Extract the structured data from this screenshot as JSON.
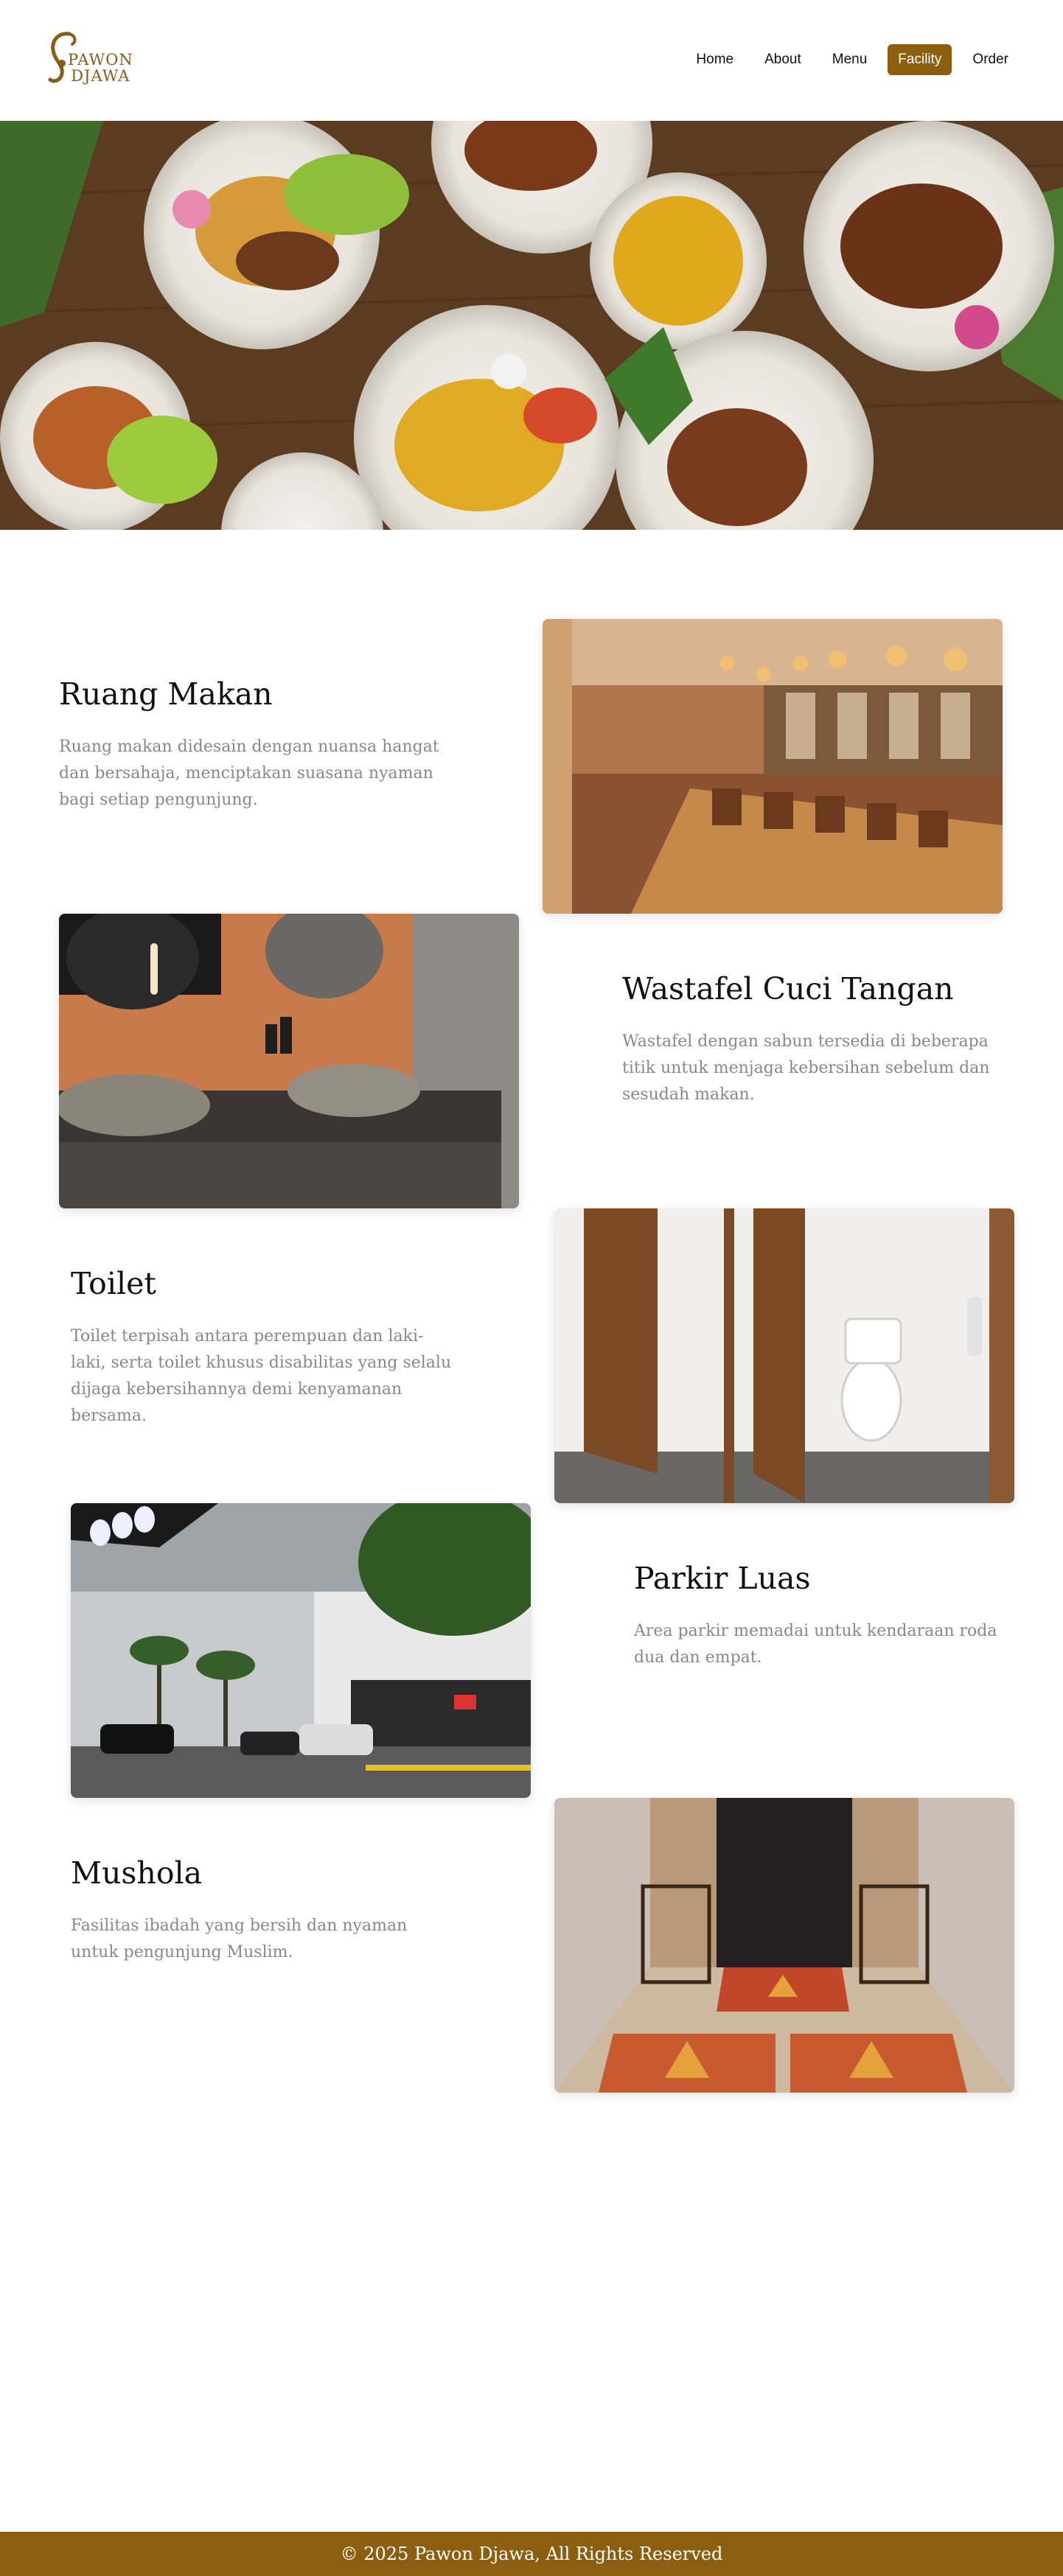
{
  "brand": {
    "logo_line1": "PAWON",
    "logo_line2": "DJAWA",
    "accent_color": "#8b5e10"
  },
  "nav": [
    {
      "label": "Home",
      "active": false
    },
    {
      "label": "About",
      "active": false
    },
    {
      "label": "Menu",
      "active": false
    },
    {
      "label": "Facility",
      "active": true
    },
    {
      "label": "Order",
      "active": false
    }
  ],
  "facilities": [
    {
      "title": "Ruang Makan",
      "description": "Ruang makan didesain dengan nuansa hangat dan bersahaja, menciptakan suasana nyaman bagi setiap pengunjung.",
      "image": "dining-room-photo"
    },
    {
      "title": "Wastafel Cuci Tangan",
      "description": "Wastafel dengan sabun tersedia di beberapa titik untuk menjaga kebersihan sebelum dan sesudah makan.",
      "image": "sink-photo"
    },
    {
      "title": "Toilet",
      "description": "Toilet terpisah antara perempuan dan laki-laki, serta toilet khusus disabilitas yang selalu dijaga kebersihannya demi kenyamanan bersama.",
      "image": "toilet-photo"
    },
    {
      "title": "Parkir Luas",
      "description": "Area parkir memadai untuk kendaraan roda dua dan empat.",
      "image": "parking-photo"
    },
    {
      "title": "Mushola",
      "description": "Fasilitas ibadah yang bersih dan nyaman untuk pengunjung Muslim.",
      "image": "prayer-room-photo"
    }
  ],
  "footer": {
    "text": "© 2025 Pawon Djawa, All Rights Reserved"
  }
}
